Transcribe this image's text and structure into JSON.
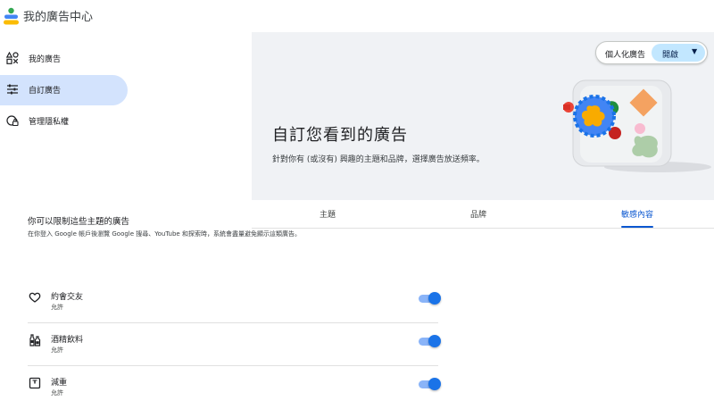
{
  "app": {
    "title": "我的廣告中心",
    "logo": "ads-center-logo-icon"
  },
  "sidebar": {
    "items": [
      {
        "label": "我的廣告",
        "icon": "shapes-icon",
        "active": false
      },
      {
        "label": "自訂廣告",
        "icon": "tune-icon",
        "active": true
      },
      {
        "label": "管理隱私權",
        "icon": "privacy-icon",
        "active": false
      }
    ]
  },
  "header": {
    "personalization_label": "個人化廣告",
    "personalization_value": "開啟",
    "title": "自訂您看到的廣告",
    "subtitle": "針對你有 (或沒有) 興趣的主題和品牌，選擇廣告放送頻率。"
  },
  "tabs": [
    {
      "label": "主題",
      "active": false
    },
    {
      "label": "品牌",
      "active": false
    },
    {
      "label": "敏感內容",
      "active": true
    }
  ],
  "section": {
    "title": "你可以限制這些主題的廣告",
    "description": "在你登入 Google 帳戶後瀏覽 Google 搜尋、YouTube 和探索時，系統會盡量避免顯示這類廣告。"
  },
  "topics": [
    {
      "title": "約會交友",
      "status": "允許",
      "icon": "heart-icon",
      "enabled": true
    },
    {
      "title": "酒精飲料",
      "status": "允許",
      "icon": "bottles-icon",
      "enabled": true
    },
    {
      "title": "減重",
      "status": "允許",
      "icon": "scale-icon",
      "enabled": true
    }
  ],
  "colors": {
    "accent": "#0b57d0",
    "active_nav": "#d3e3fd",
    "hero_bg": "#f0f2f5",
    "switch_on": "#1a73e8"
  }
}
